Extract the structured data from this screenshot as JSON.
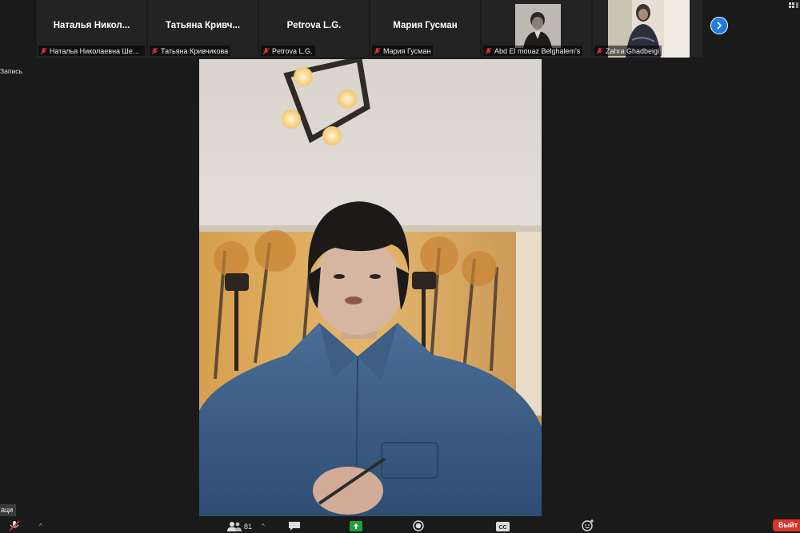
{
  "participants": [
    {
      "display": "Наталья  Никол...",
      "label": "Наталья Николаевна Шев..."
    },
    {
      "display": "Татьяна  Кривч...",
      "label": "Татьяна Кривчикова"
    },
    {
      "display": "Petrova L.G.",
      "label": "Petrova L.G."
    },
    {
      "display": "Мария Гусман",
      "label": "Мария Гусман"
    },
    {
      "display": "",
      "label": "Abd El mouaz Belghalem's"
    },
    {
      "display": "",
      "label": "Zahra Ghadbeigi"
    }
  ],
  "recording": {
    "label": "Запись"
  },
  "toolbar": {
    "participants_count": "81",
    "tooltip_text": "аци",
    "end_label": "Выйт"
  },
  "colors": {
    "accent_blue": "#1e7be0",
    "muted_red": "#d9342b",
    "share_green": "#23a03c"
  },
  "icons": {
    "next_page": "chevron-right-icon",
    "mic_muted": "mic-muted-icon",
    "participants": "participants-icon",
    "chat": "chat-icon",
    "share": "share-screen-icon",
    "record": "record-icon",
    "captions": "cc-icon",
    "reactions": "reactions-icon"
  }
}
